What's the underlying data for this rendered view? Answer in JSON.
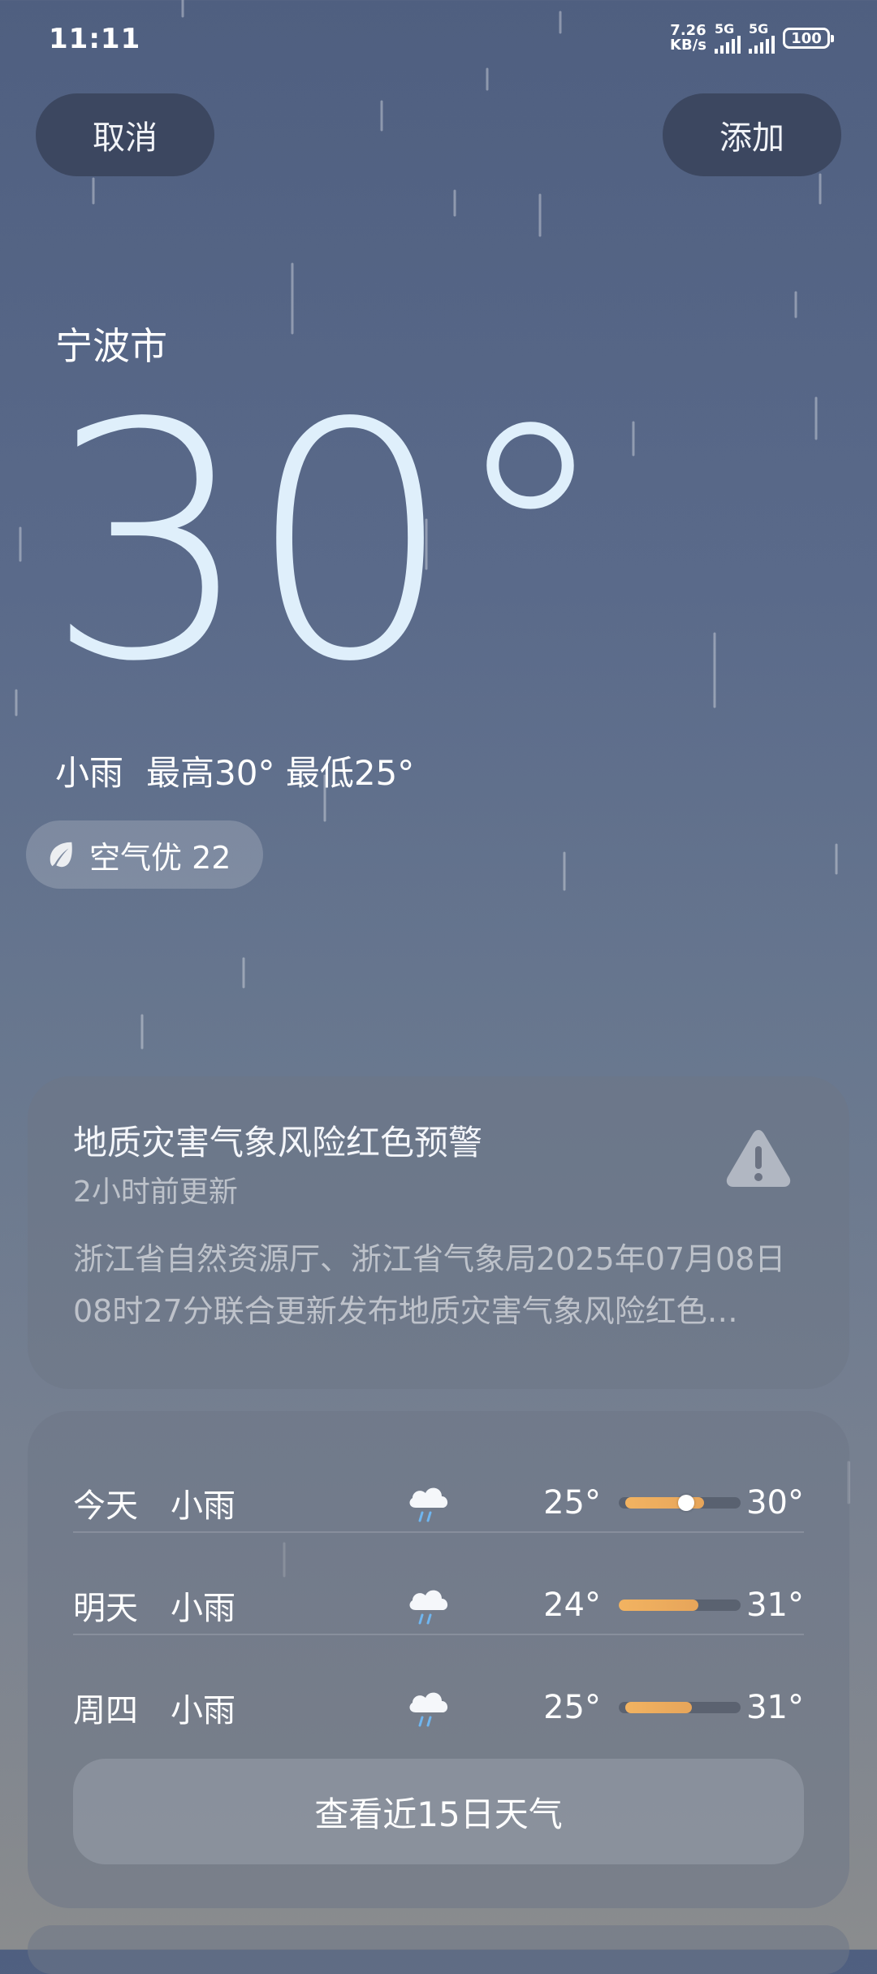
{
  "status_bar": {
    "time": "11:11",
    "net_speed_value": "7.26",
    "net_speed_unit": "KB/s",
    "sim1": "5G",
    "sim2": "5G",
    "battery": "100"
  },
  "header": {
    "cancel_label": "取消",
    "add_label": "添加"
  },
  "weather": {
    "city": "宁波市",
    "temperature": "30°",
    "condition": "小雨",
    "high": "最高30°",
    "low": "最低25°",
    "aqi_label": "空气优 22"
  },
  "alert": {
    "title": "地质灾害气象风险红色预警",
    "updated": "2小时前更新",
    "body": "浙江省自然资源厅、浙江省气象局2025年07月08日08时27分联合更新发布地质灾害气象风险红色…"
  },
  "forecast": {
    "days": [
      {
        "day": "今天",
        "condition": "小雨",
        "low": "25°",
        "high": "30°",
        "range_start": 0.05,
        "range_end": 0.7,
        "current": 0.55,
        "icon": "rain-cloud-icon"
      },
      {
        "day": "明天",
        "condition": "小雨",
        "low": "24°",
        "high": "31°",
        "range_start": 0.0,
        "range_end": 0.65,
        "icon": "rain-cloud-icon"
      },
      {
        "day": "周四",
        "condition": "小雨",
        "low": "25°",
        "high": "31°",
        "range_start": 0.05,
        "range_end": 0.6,
        "icon": "rain-cloud-icon"
      }
    ],
    "more_label": "查看近15日天气"
  },
  "colors": {
    "bar_fill": "#f2b361",
    "temp_text": "#dfeffb"
  }
}
